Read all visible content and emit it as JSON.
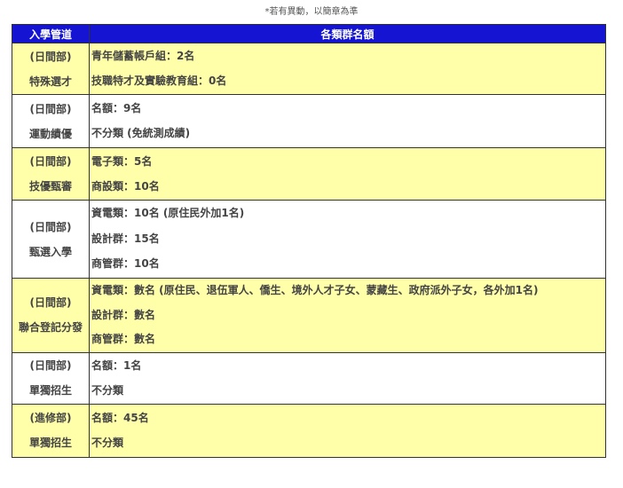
{
  "note": "*若有異動，以簡章為準",
  "headers": {
    "path": "入學管道",
    "quota": "各類群名額"
  },
  "rows": [
    {
      "division": "(日間部)",
      "name": "特殊選才",
      "lines": [
        "青年儲蓄帳戶組：2名",
        "技職特才及實驗教育組：0名"
      ]
    },
    {
      "division": "(日間部)",
      "name": "運動績優",
      "lines": [
        "名額：9名",
        "不分類 (免統測成績)"
      ]
    },
    {
      "division": "(日間部)",
      "name": "技優甄審",
      "lines": [
        "電子類：5名",
        "商設類：10名"
      ]
    },
    {
      "division": "(日間部)",
      "name": "甄選入學",
      "lines": [
        "資電類：10名 (原住民外加1名)",
        "設計群：15名",
        "商管群：10名"
      ]
    },
    {
      "division": "(日間部)",
      "name": "聯合登記分發",
      "lines": [
        "資電類：數名 (原住民、退伍軍人、僑生、境外人才子女、蒙藏生、政府派外子女，各外加1名)",
        "設計群：數名",
        "商管群：數名"
      ]
    },
    {
      "division": "(日間部)",
      "name": "單獨招生",
      "lines": [
        "名額：1名",
        "不分類"
      ]
    },
    {
      "division": "(進修部)",
      "name": "單獨招生",
      "lines": [
        "名額：45名",
        "不分類"
      ]
    }
  ]
}
